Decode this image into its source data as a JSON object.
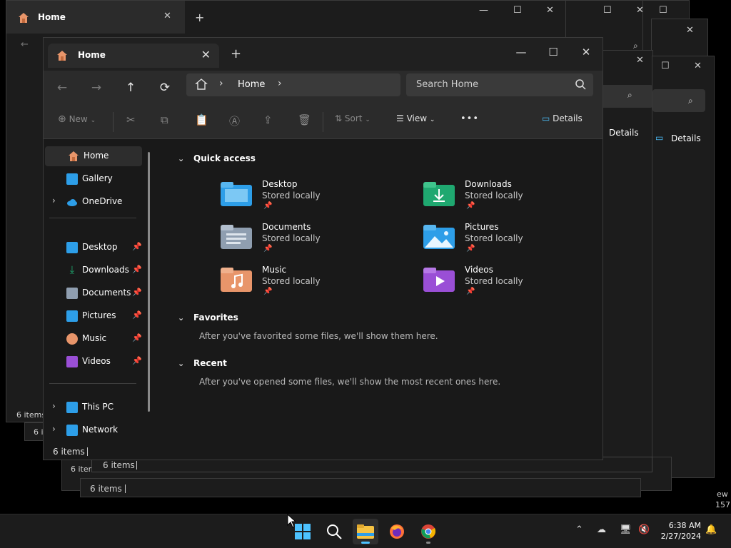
{
  "background_windows": {
    "tab_title": "Home",
    "details_label": "Details",
    "status_items": "6 items",
    "edge_text_1": "ew",
    "edge_text_2": "157"
  },
  "window": {
    "tab_title": "Home",
    "tab_close": "✕",
    "new_tab": "+",
    "minimize": "—",
    "maximize": "☐",
    "close": "✕"
  },
  "nav": {
    "back": "←",
    "forward": "→",
    "up": "↑",
    "refresh": "⟳",
    "breadcrumb_home": "Home",
    "search_placeholder": "Search Home"
  },
  "toolbar": {
    "new_label": "New",
    "sort_label": "Sort",
    "view_label": "View",
    "more_label": "•••",
    "details_label": "Details"
  },
  "sidebar": {
    "home": "Home",
    "gallery": "Gallery",
    "onedrive": "OneDrive",
    "desktop": "Desktop",
    "downloads": "Downloads",
    "documents": "Documents",
    "pictures": "Pictures",
    "music": "Music",
    "videos": "Videos",
    "this_pc": "This PC",
    "network": "Network"
  },
  "content": {
    "quick_access_header": "Quick access",
    "favorites_header": "Favorites",
    "favorites_message": "After you've favorited some files, we'll show them here.",
    "recent_header": "Recent",
    "recent_message": "After you've opened some files, we'll show the most recent ones here.",
    "quick_access": [
      {
        "name": "Desktop",
        "sub": "Stored locally"
      },
      {
        "name": "Downloads",
        "sub": "Stored locally"
      },
      {
        "name": "Documents",
        "sub": "Stored locally"
      },
      {
        "name": "Pictures",
        "sub": "Stored locally"
      },
      {
        "name": "Music",
        "sub": "Stored locally"
      },
      {
        "name": "Videos",
        "sub": "Stored locally"
      }
    ]
  },
  "status": {
    "item_count": "6 items"
  },
  "taskbar": {
    "time": "6:38 AM",
    "date": "2/27/2024",
    "apps": [
      "start-icon",
      "search-icon",
      "file-explorer-icon",
      "firefox-icon",
      "chrome-icon"
    ]
  },
  "colors": {
    "accent": "#4cc2ff",
    "folder_blue": "#2d9ee8",
    "folder_green": "#1fa870",
    "folder_gray": "#8f9eb0",
    "folder_orange": "#e8956a",
    "folder_purple": "#9a4fd6"
  }
}
